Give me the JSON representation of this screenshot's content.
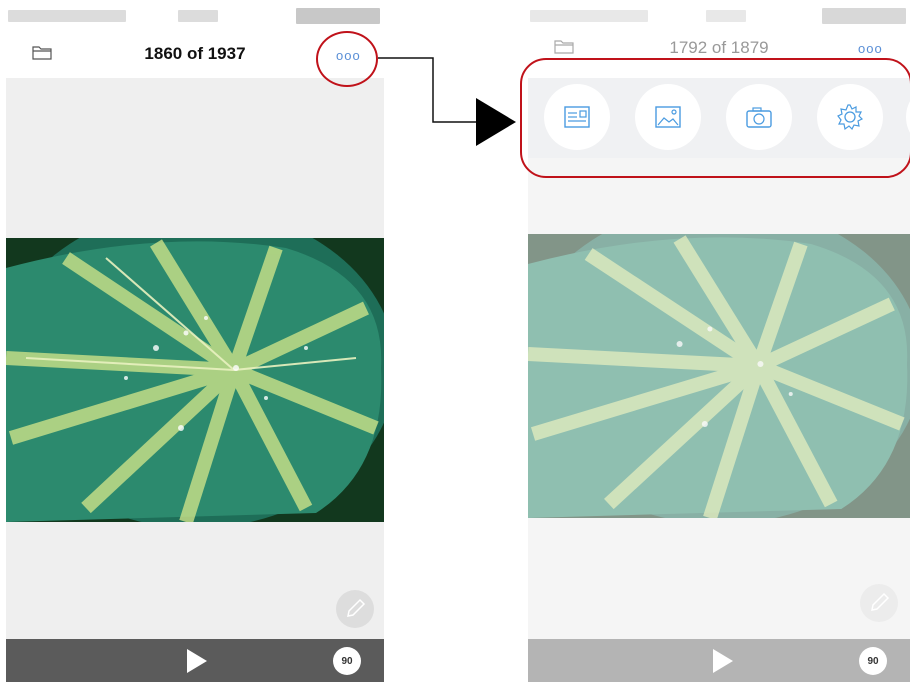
{
  "left_screen": {
    "title": "1860 of 1937",
    "more_label": "ooo",
    "rotate_label": "90"
  },
  "right_screen": {
    "title": "1792 of 1879",
    "more_label": "ooo",
    "rotate_label": "90",
    "toolbar_items": [
      {
        "icon": "document-icon"
      },
      {
        "icon": "image-icon"
      },
      {
        "icon": "camera-icon"
      },
      {
        "icon": "gear-icon"
      }
    ]
  },
  "colors": {
    "accent_blue": "#5a8fd6",
    "highlight_red": "#c0121a",
    "bottom_bar": "#5b5b5b",
    "content_bg": "#efefef"
  }
}
